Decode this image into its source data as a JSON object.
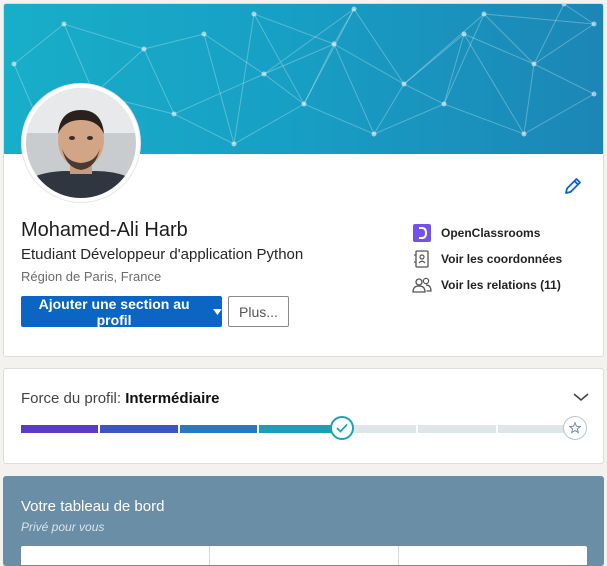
{
  "profile": {
    "name": "Mohamed-Ali Harb",
    "headline": "Etudiant Développeur d'application Python",
    "location": "Région de Paris, France",
    "add_section_label": "Ajouter une section au profil",
    "more_label": "Plus..."
  },
  "side_links": [
    {
      "label": "OpenClassrooms",
      "icon": "openclassrooms-logo"
    },
    {
      "label": "Voir les coordonnées",
      "icon": "contact-card-icon"
    },
    {
      "label": "Voir les relations (11)",
      "icon": "people-icon"
    }
  ],
  "strength": {
    "prefix": "Force du profil: ",
    "level": "Intermédiaire",
    "progress_fraction": 0.58
  },
  "dashboard": {
    "title": "Votre tableau de bord",
    "subtitle": "Privé pour vous"
  },
  "colors": {
    "primary": "#0a66c2",
    "banner": "#17a0c5",
    "openclassrooms": "#7451eb",
    "dashboard": "#6a8ea5"
  }
}
